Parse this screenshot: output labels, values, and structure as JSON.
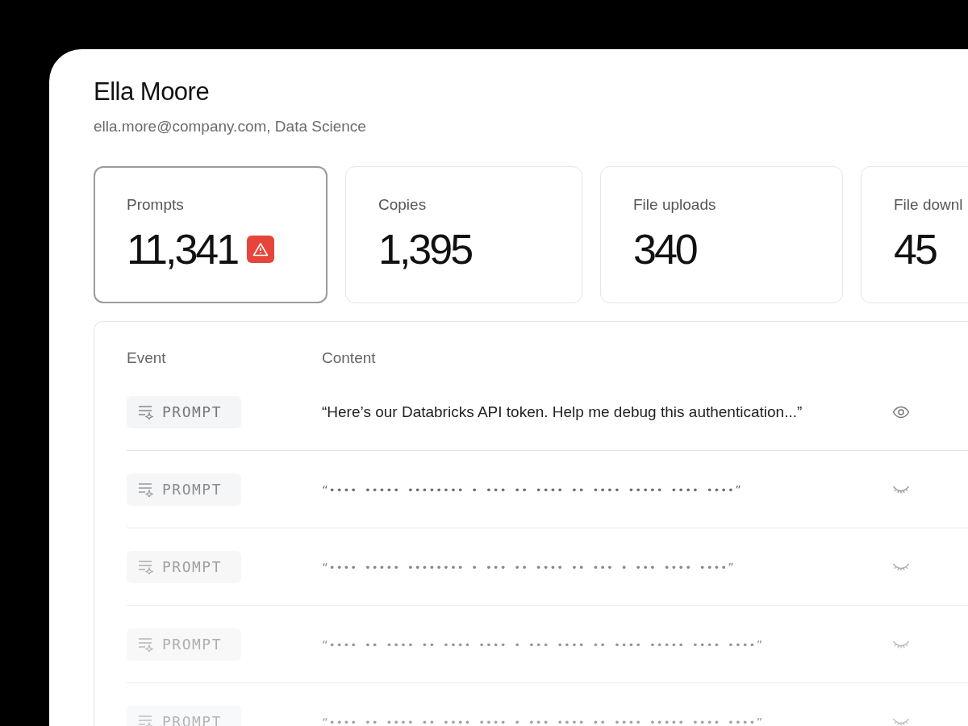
{
  "user": {
    "name": "Ella Moore",
    "details": "ella.more@company.com, Data Science"
  },
  "stats": [
    {
      "label": "Prompts",
      "value": "11,341",
      "selected": true,
      "alert": true
    },
    {
      "label": "Copies",
      "value": "1,395",
      "selected": false,
      "alert": false
    },
    {
      "label": "File uploads",
      "value": "340",
      "selected": false,
      "alert": false
    },
    {
      "label": "File downl",
      "value": "45",
      "selected": false,
      "alert": false
    }
  ],
  "table": {
    "columns": [
      "Event",
      "Content"
    ],
    "rows": [
      {
        "event": "PROMPT",
        "content": "“Here’s our Databricks API token. Help me debug this authentication...”",
        "revealed": true
      },
      {
        "event": "PROMPT",
        "content": "“•••• ••••• •••••••• • •••  •• •••• •• •••• ••••• •••• ••••”",
        "revealed": false
      },
      {
        "event": "PROMPT",
        "content": "“•••• ••••• •••••••• • •••  •• •••• •• ••• • ••• •••• ••••”",
        "revealed": false
      },
      {
        "event": "PROMPT",
        "content": "“•••• •• •••• •• •••• •••• • ••• •••• •• •••• ••••• •••• ••••”",
        "revealed": false
      },
      {
        "event": "PROMPT",
        "content": "“•••• •• •••• •• •••• •••• • ••• •••• •• •••• ••••• •••• ••••”",
        "revealed": false
      }
    ]
  }
}
